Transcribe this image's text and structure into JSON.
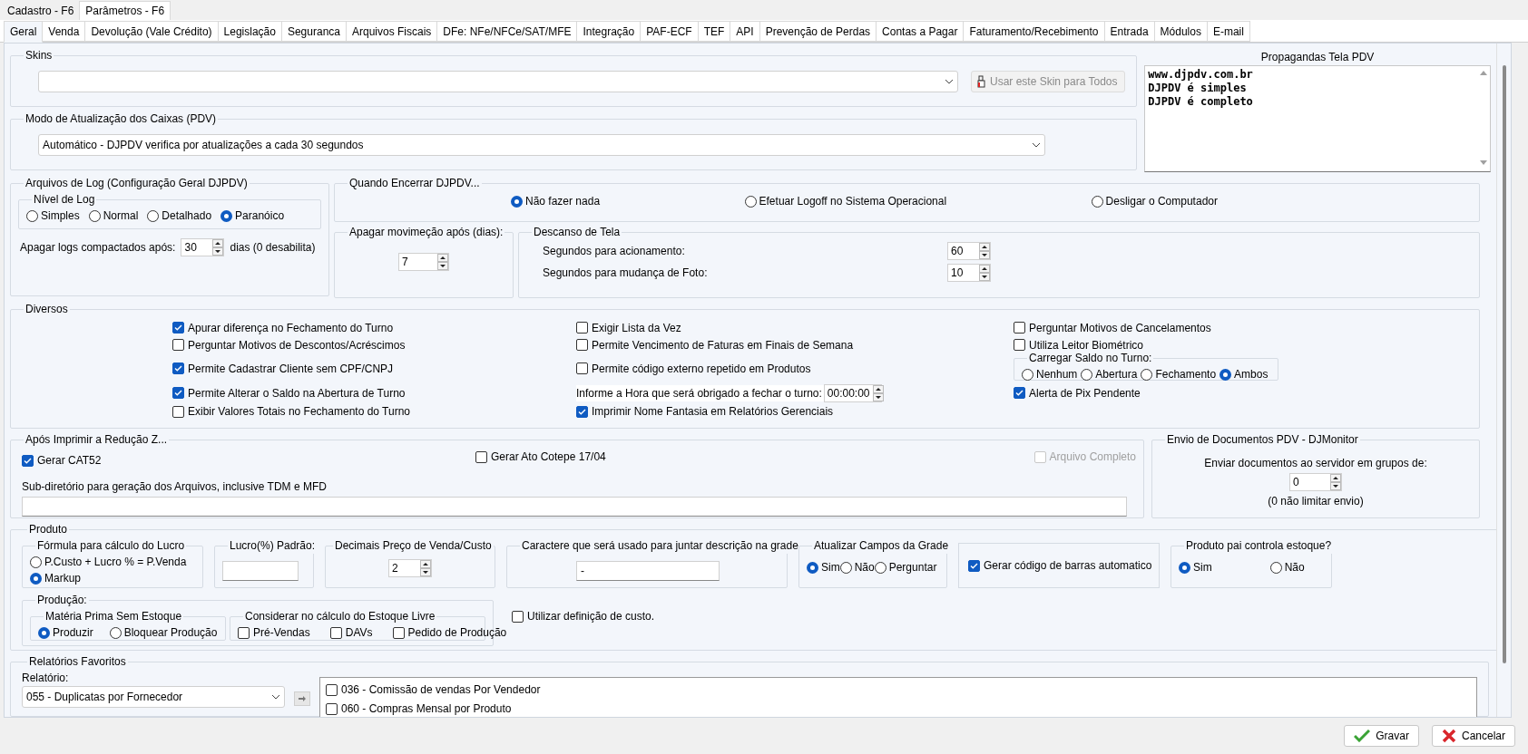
{
  "window_tabs": [
    {
      "label": "Cadastro - F6",
      "selected": false
    },
    {
      "label": "Parâmetros - F6",
      "selected": true
    }
  ],
  "tabs": [
    {
      "label": "Geral",
      "selected": true
    },
    {
      "label": "Venda",
      "selected": false
    },
    {
      "label": "Devolução (Vale Crédito)",
      "selected": false
    },
    {
      "label": "Legislação",
      "selected": false
    },
    {
      "label": "Seguranca",
      "selected": false
    },
    {
      "label": "Arquivos Fiscais",
      "selected": false
    },
    {
      "label": "DFe: NFe/NFCe/SAT/MFE",
      "selected": false
    },
    {
      "label": "Integração",
      "selected": false
    },
    {
      "label": "PAF-ECF",
      "selected": false
    },
    {
      "label": "TEF",
      "selected": false
    },
    {
      "label": "API",
      "selected": false
    },
    {
      "label": "Prevenção de Perdas",
      "selected": false
    },
    {
      "label": "Contas a Pagar",
      "selected": false
    },
    {
      "label": "Faturamento/Recebimento",
      "selected": false
    },
    {
      "label": "Entrada",
      "selected": false
    },
    {
      "label": "Módulos",
      "selected": false
    },
    {
      "label": "E-mail",
      "selected": false
    }
  ],
  "skins": {
    "title": "Skins",
    "button": {
      "label": "Usar este Skin para Todos",
      "disabled": true
    }
  },
  "update_mode": {
    "title": "Modo de Atualização dos Caixas (PDV)",
    "value": "Automático - DJPDV verifica por atualizações a cada 30 segundos"
  },
  "ads": {
    "title": "Propagandas Tela PDV",
    "lines": [
      "www.djpdv.com.br",
      "DJPDV é simples",
      "DJPDV é completo"
    ]
  },
  "log": {
    "title": "Arquivos de Log (Configuração Geral DJPDV)",
    "level_title": "Nível de Log",
    "levels": [
      {
        "label": "Simples",
        "selected": false
      },
      {
        "label": "Normal",
        "selected": false
      },
      {
        "label": "Detalhado",
        "selected": false
      },
      {
        "label": "Paranóico",
        "selected": true
      }
    ],
    "keep_label": "Apagar logs compactados após:",
    "keep_value": "30",
    "keep_suffix": "dias (0 desabilita)"
  },
  "on_exit": {
    "title": "Quando Encerrar DJPDV...",
    "options": [
      {
        "label": "Não fazer nada",
        "selected": true
      },
      {
        "label": "Efetuar Logoff no Sistema Operacional",
        "selected": false
      },
      {
        "label": "Desligar o Computador",
        "selected": false
      }
    ]
  },
  "movement": {
    "title": "Apagar movimeção após (dias):",
    "value": "7"
  },
  "screensaver": {
    "title": "Descanso de Tela",
    "rows": [
      {
        "label": "Segundos para acionamento:",
        "value": "60"
      },
      {
        "label": "Segundos para mudança de Foto:",
        "value": "10"
      }
    ]
  },
  "misc": {
    "title": "Diversos",
    "columns": [
      [
        {
          "kind": "checkbox",
          "label": "Apurar diferença no Fechamento do Turno",
          "checked": true
        },
        {
          "kind": "checkbox",
          "label": "Perguntar Motivos de Descontos/Acréscimos",
          "checked": false
        },
        {
          "kind": "checkbox",
          "label": "Permite Cadastrar Cliente sem CPF/CNPJ",
          "checked": true
        },
        {
          "kind": "checkbox",
          "label": "Permite Alterar o Saldo na Abertura de Turno",
          "checked": true
        },
        {
          "kind": "checkbox",
          "label": "Exibir Valores Totais no Fechamento do Turno",
          "checked": false
        }
      ],
      [
        {
          "kind": "checkbox",
          "label": "Exigir Lista da Vez",
          "checked": false
        },
        {
          "kind": "checkbox",
          "label": "Permite Vencimento de Faturas em Finais de Semana",
          "checked": false
        },
        {
          "kind": "checkbox",
          "label": "Permite código externo repetido em Produtos",
          "checked": false
        },
        {
          "kind": "time",
          "label": "Informe a Hora que será obrigado a fechar o turno:",
          "value": "00:00:00"
        },
        {
          "kind": "checkbox",
          "label": "Imprimir Nome Fantasia em Relatórios Gerenciais",
          "checked": true
        }
      ],
      [
        {
          "kind": "checkbox",
          "label": "Perguntar Motivos de Cancelamentos",
          "checked": false
        },
        {
          "kind": "checkbox",
          "label": "Utiliza Leitor Biométrico",
          "checked": false
        },
        {
          "kind": "radio_group",
          "title": "Carregar Saldo no Turno:",
          "options": [
            {
              "label": "Nenhum",
              "selected": false
            },
            {
              "label": "Abertura",
              "selected": false
            },
            {
              "label": "Fechamento",
              "selected": false
            },
            {
              "label": "Ambos",
              "selected": true
            }
          ]
        },
        {
          "kind": "checkbox",
          "label": "Alerta de Pix Pendente",
          "checked": true
        }
      ]
    ]
  },
  "after_z": {
    "title": "Após Imprimir a Redução Z...",
    "items": [
      {
        "label": "Gerar CAT52",
        "checked": true,
        "disabled": false
      },
      {
        "label": "Gerar Ato Cotepe 17/04",
        "checked": false,
        "disabled": false
      },
      {
        "label": "Arquivo Completo",
        "checked": false,
        "disabled": true
      }
    ],
    "dir_label": "Sub-diretório para geração dos Arquivos, inclusive TDM e MFD"
  },
  "monitor": {
    "title": "Envio de Documentos PDV - DJMonitor",
    "label": "Enviar documentos ao servidor em grupos de:",
    "value": "0",
    "note": "(0 não limitar envio)"
  },
  "product": {
    "title": "Produto",
    "profit_formula": {
      "title": "Fórmula para cálculo do Lucro",
      "options": [
        {
          "label": "P.Custo + Lucro % = P.Venda",
          "selected": false
        },
        {
          "label": "Markup",
          "selected": true
        }
      ]
    },
    "default_profit": {
      "title": "Lucro(%) Padrão:"
    },
    "decimals": {
      "title": "Decimais Preço de Venda/Custo",
      "value": "2"
    },
    "join_char": {
      "title": "Caractere que será usado para juntar descrição na grade",
      "value": "-"
    },
    "update_grid": {
      "title": "Atualizar Campos da Grade",
      "options": [
        {
          "label": "Sim",
          "selected": true
        },
        {
          "label": "Não",
          "selected": false
        },
        {
          "label": "Perguntar",
          "selected": false
        }
      ]
    },
    "barcode": {
      "label": "Gerar código de barras automatico",
      "checked": true
    },
    "parent_stock": {
      "title": "Produto pai controla estoque?",
      "options": [
        {
          "label": "Sim",
          "selected": true
        },
        {
          "label": "Não",
          "selected": false
        }
      ]
    },
    "production": {
      "title": "Produção:",
      "raw": {
        "title": "Matéria Prima Sem Estoque",
        "options": [
          {
            "label": "Produzir",
            "selected": true
          },
          {
            "label": "Bloquear Produção",
            "selected": false
          }
        ]
      },
      "consider": {
        "title": "Considerar no cálculo do Estoque Livre",
        "items": [
          {
            "label": "Pré-Vendas",
            "checked": false
          },
          {
            "label": "DAVs",
            "checked": false
          },
          {
            "label": "Pedido de Produção",
            "checked": false
          }
        ]
      }
    },
    "cost_def": {
      "label": "Utilizar definição de custo.",
      "checked": false
    }
  },
  "favorites": {
    "title": "Relatórios Favoritos",
    "report_label": "Relatório:",
    "report_value": "055 - Duplicatas por Fornecedor",
    "items": [
      {
        "label": "036 - Comissão de vendas Por Vendedor",
        "checked": false
      },
      {
        "label": "060 - Compras Mensal por Produto",
        "checked": false
      }
    ]
  },
  "footer": [
    {
      "kind": "save",
      "label": "Gravar"
    },
    {
      "kind": "cancel",
      "label": "Cancelar"
    }
  ]
}
